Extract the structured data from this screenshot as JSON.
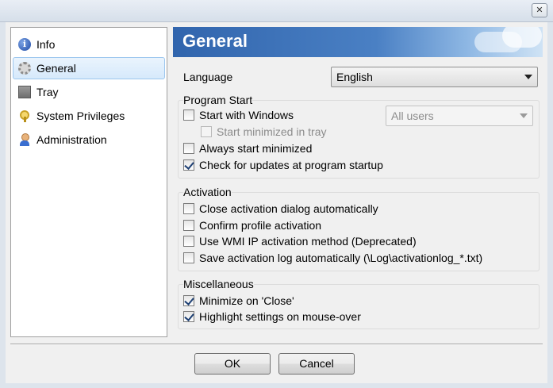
{
  "window": {
    "close_glyph": "✕"
  },
  "sidebar": {
    "items": [
      {
        "label": "Info",
        "icon": "info-icon",
        "selected": false
      },
      {
        "label": "General",
        "icon": "gear-icon",
        "selected": true
      },
      {
        "label": "Tray",
        "icon": "tray-icon",
        "selected": false
      },
      {
        "label": "System Privileges",
        "icon": "key-icon",
        "selected": false
      },
      {
        "label": "Administration",
        "icon": "user-icon",
        "selected": false
      }
    ]
  },
  "header": {
    "title": "General"
  },
  "language": {
    "label": "Language",
    "value": "English"
  },
  "program_start": {
    "title": "Program Start",
    "start_with_windows": {
      "label": "Start with Windows",
      "checked": false
    },
    "users_select": {
      "value": "All users",
      "disabled": true
    },
    "start_minimized_tray": {
      "label": "Start minimized in tray",
      "checked": false,
      "disabled": true
    },
    "always_start_minimized": {
      "label": "Always start minimized",
      "checked": false
    },
    "check_updates": {
      "label": "Check for updates at program startup",
      "checked": true
    }
  },
  "activation": {
    "title": "Activation",
    "close_dialog": {
      "label": "Close activation dialog automatically",
      "checked": false
    },
    "confirm_profile": {
      "label": "Confirm profile activation",
      "checked": false
    },
    "wmi_method": {
      "label": "Use WMI IP activation method (Deprecated)",
      "checked": false
    },
    "save_log": {
      "label": "Save activation log automatically (\\Log\\activationlog_*.txt)",
      "checked": false
    }
  },
  "misc": {
    "title": "Miscellaneous",
    "minimize_close": {
      "label": "Minimize on 'Close'",
      "checked": true
    },
    "highlight_settings": {
      "label": "Highlight settings on mouse-over",
      "checked": true
    }
  },
  "buttons": {
    "ok": "OK",
    "cancel": "Cancel"
  },
  "colors": {
    "banner": "#3165ad",
    "selection": "#d6e9fb",
    "check": "#1d3f73"
  }
}
